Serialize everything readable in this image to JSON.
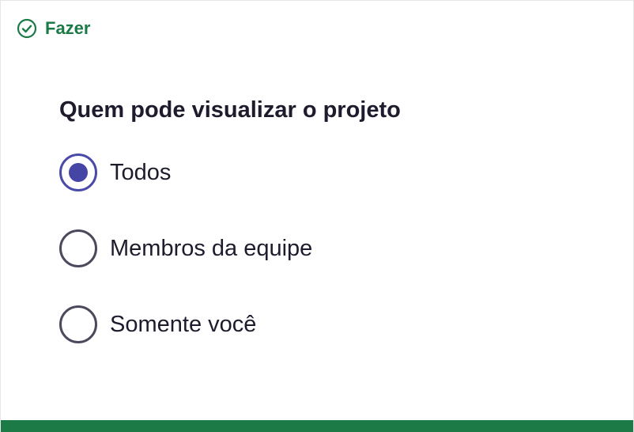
{
  "header": {
    "label": "Fazer",
    "icon": "check-circle-icon",
    "color": "#1b7a46"
  },
  "question": {
    "title": "Quem pode visualizar o projeto"
  },
  "options": [
    {
      "label": "Todos",
      "selected": true
    },
    {
      "label": "Membros da equipe",
      "selected": false
    },
    {
      "label": "Somente você",
      "selected": false
    }
  ],
  "colors": {
    "accent": "#4545a6",
    "brand": "#1b7a46",
    "text": "#1f1b2d"
  }
}
